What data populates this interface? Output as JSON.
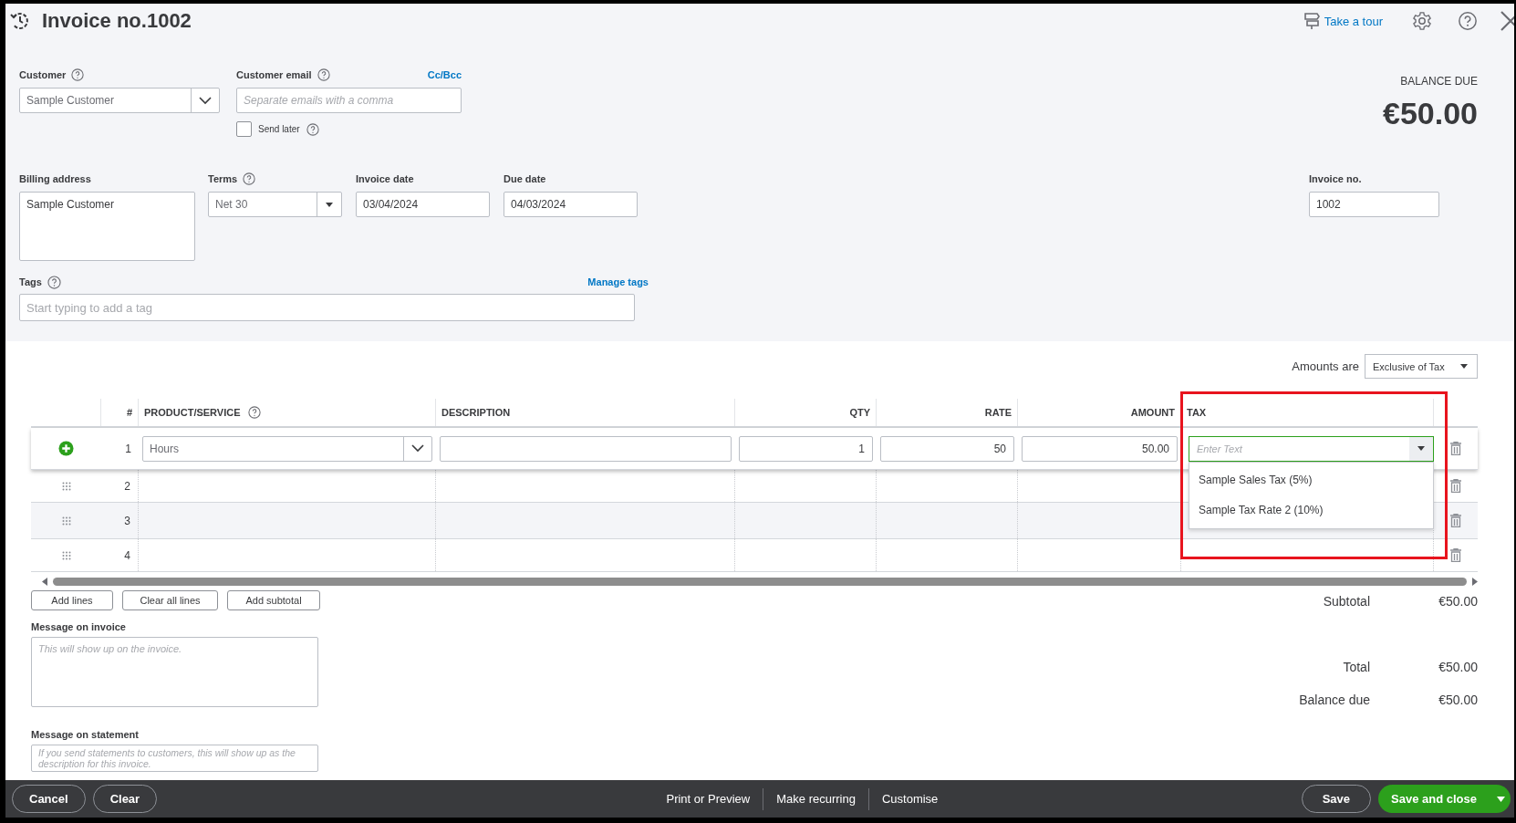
{
  "header": {
    "title": "Invoice no.1002",
    "tour_link": "Take a tour"
  },
  "customer": {
    "label": "Customer",
    "value": "Sample Customer"
  },
  "customer_email": {
    "label": "Customer email",
    "placeholder": "Separate emails with a comma",
    "cc_bcc": "Cc/Bcc"
  },
  "send_later": {
    "label": "Send later",
    "checked": false
  },
  "balance": {
    "label": "BALANCE DUE",
    "amount": "€50.00"
  },
  "billing_address": {
    "label": "Billing address",
    "value": "Sample Customer"
  },
  "terms": {
    "label": "Terms",
    "value": "Net 30"
  },
  "invoice_date": {
    "label": "Invoice date",
    "value": "03/04/2024"
  },
  "due_date": {
    "label": "Due date",
    "value": "04/03/2024"
  },
  "invoice_no": {
    "label": "Invoice no.",
    "value": "1002"
  },
  "tags": {
    "label": "Tags",
    "manage_link": "Manage tags",
    "placeholder": "Start typing to add a tag"
  },
  "amounts_are": {
    "label": "Amounts are",
    "value": "Exclusive of Tax"
  },
  "table": {
    "columns": [
      "#",
      "PRODUCT/SERVICE",
      "DESCRIPTION",
      "QTY",
      "RATE",
      "AMOUNT",
      "TAX"
    ],
    "tax_highlighted": true,
    "rows": [
      {
        "number": "1",
        "editing": true,
        "hovered": false,
        "product": "Hours",
        "qty": "1",
        "rate": "50",
        "amount": "50.00",
        "tax_placeholder": "Enter Text",
        "tax_open": true,
        "tax_options": [
          "Sample Sales Tax (5%)",
          "Sample Tax Rate 2 (10%)"
        ]
      },
      {
        "number": "2",
        "editing": false,
        "hovered": false
      },
      {
        "number": "3",
        "editing": false,
        "hovered": true
      },
      {
        "number": "4",
        "editing": false,
        "hovered": false
      }
    ]
  },
  "line_buttons": [
    "Add lines",
    "Clear all lines",
    "Add subtotal"
  ],
  "message_on_invoice": {
    "label": "Message on invoice",
    "placeholder": "This will show up on the invoice."
  },
  "message_on_statement": {
    "label": "Message on statement",
    "placeholder": "If you send statements to customers, this will show up as the description for this invoice."
  },
  "totals": [
    {
      "label": "Subtotal",
      "value": "€50.00"
    },
    {
      "label": "Total",
      "value": "€50.00"
    },
    {
      "label": "Balance due",
      "value": "€50.00"
    }
  ],
  "footer": {
    "left": [
      "Cancel",
      "Clear"
    ],
    "center": [
      "Print or Preview",
      "Make recurring",
      "Customise"
    ],
    "save": "Save",
    "save_and_close": "Save and close"
  }
}
